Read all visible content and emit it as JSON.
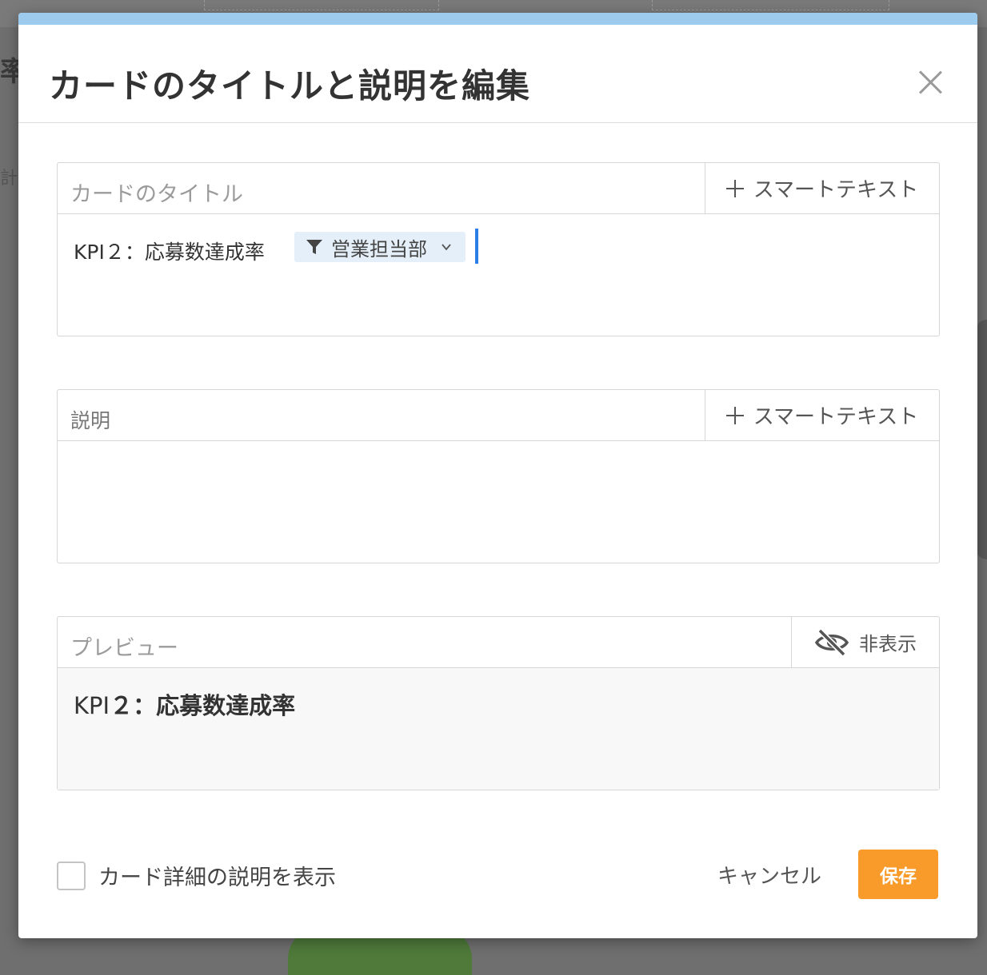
{
  "background": {
    "left_glyph_1": "率",
    "left_glyph_2": "計"
  },
  "dialog": {
    "title": "カードのタイトルと説明を編集",
    "close_icon": "close-icon",
    "accent_color": "#9ccbee"
  },
  "title_field": {
    "label": "カードのタイトル",
    "smart_text_label": "スマートテキスト",
    "value_text": "KPI２：応募数達成率",
    "filter_chip": {
      "label": "営業担当部",
      "icon": "filter-icon",
      "dropdown_icon": "chevron-down-icon"
    }
  },
  "description_field": {
    "label": "説明",
    "smart_text_label": "スマートテキスト",
    "value": ""
  },
  "preview": {
    "label": "プレビュー",
    "hide_label": "非表示",
    "hide_icon": "eye-slash-icon",
    "text_prefix": "KPI",
    "text_rest": "２：応募数達成率"
  },
  "footer": {
    "show_description_label": "カード詳細の説明を表示",
    "show_description_checked": false,
    "cancel_label": "キャンセル",
    "save_label": "保存",
    "save_color": "#f89b2a"
  }
}
